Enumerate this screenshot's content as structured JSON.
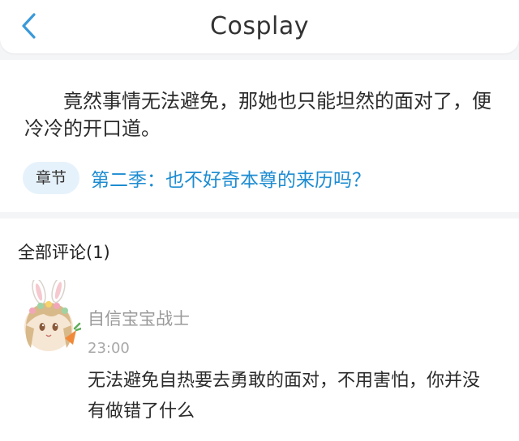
{
  "header": {
    "title": "Cosplay",
    "back_icon": "chevron-left-icon",
    "accent_color": "#3a9ad9"
  },
  "excerpt": {
    "text": "　　竟然事情无法避免，那她也只能坦然的面对了，便冷冷的开口道。"
  },
  "chapter": {
    "tag": "章节",
    "title": "第二季：也不好奇本尊的来历吗？",
    "link_color": "#1d8cd1"
  },
  "comments": {
    "header": "全部评论(1)",
    "items": [
      {
        "avatar_icon": "bunny-girl-avatar",
        "username": "自信宝宝战士",
        "time": "23:00",
        "text": "无法避免自热要去勇敢的面对，不用害怕，你并没有做错了什么"
      }
    ]
  }
}
